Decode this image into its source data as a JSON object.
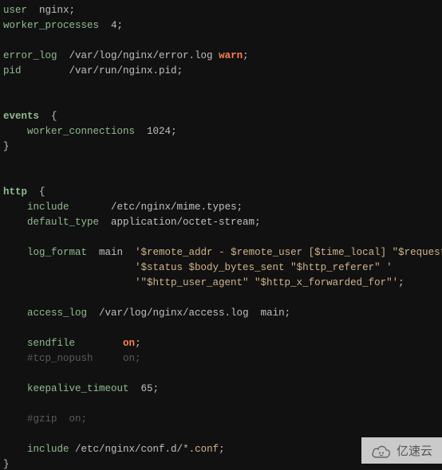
{
  "lines": [
    {
      "indent": 0,
      "segs": [
        {
          "c": "dir",
          "t": "user"
        },
        {
          "c": "val",
          "t": "  nginx"
        },
        {
          "c": "sc",
          "t": ";"
        }
      ]
    },
    {
      "indent": 0,
      "segs": [
        {
          "c": "dir",
          "t": "worker_processes"
        },
        {
          "c": "val",
          "t": "  4"
        },
        {
          "c": "sc",
          "t": ";"
        }
      ]
    },
    {
      "indent": 0,
      "segs": []
    },
    {
      "indent": 0,
      "segs": [
        {
          "c": "dir",
          "t": "error_log"
        },
        {
          "c": "val",
          "t": "  /var/log/nginx/error.log "
        },
        {
          "c": "kw",
          "t": "warn"
        },
        {
          "c": "sc",
          "t": ";"
        }
      ]
    },
    {
      "indent": 0,
      "segs": [
        {
          "c": "dir",
          "t": "pid"
        },
        {
          "c": "val",
          "t": "        /var/run/nginx.pid"
        },
        {
          "c": "sc",
          "t": ";"
        }
      ]
    },
    {
      "indent": 0,
      "segs": []
    },
    {
      "indent": 0,
      "segs": []
    },
    {
      "indent": 0,
      "segs": [
        {
          "c": "dir-b",
          "t": "events"
        },
        {
          "c": "br",
          "t": "  {"
        }
      ]
    },
    {
      "indent": 4,
      "segs": [
        {
          "c": "dir",
          "t": "worker_connections"
        },
        {
          "c": "val",
          "t": "  1024"
        },
        {
          "c": "sc",
          "t": ";"
        }
      ]
    },
    {
      "indent": 0,
      "segs": [
        {
          "c": "br",
          "t": "}"
        }
      ]
    },
    {
      "indent": 0,
      "segs": []
    },
    {
      "indent": 0,
      "segs": []
    },
    {
      "indent": 0,
      "segs": [
        {
          "c": "dir-b",
          "t": "http"
        },
        {
          "c": "br",
          "t": "  {"
        }
      ]
    },
    {
      "indent": 4,
      "segs": [
        {
          "c": "dir",
          "t": "include"
        },
        {
          "c": "val",
          "t": "       /etc/nginx/mime.types"
        },
        {
          "c": "sc",
          "t": ";"
        }
      ]
    },
    {
      "indent": 4,
      "segs": [
        {
          "c": "dir",
          "t": "default_type"
        },
        {
          "c": "val",
          "t": "  application/octet-stream"
        },
        {
          "c": "sc",
          "t": ";"
        }
      ]
    },
    {
      "indent": 0,
      "segs": []
    },
    {
      "indent": 4,
      "segs": [
        {
          "c": "dir",
          "t": "log_format"
        },
        {
          "c": "val",
          "t": "  main  "
        },
        {
          "c": "str",
          "t": "'$remote_addr - $remote_user [$time_local] \"$request\" '"
        }
      ]
    },
    {
      "indent": 22,
      "segs": [
        {
          "c": "str",
          "t": "'$status $body_bytes_sent \"$http_referer\" '"
        }
      ]
    },
    {
      "indent": 22,
      "segs": [
        {
          "c": "str",
          "t": "'\"$http_user_agent\" \"$http_x_forwarded_for\"'"
        },
        {
          "c": "sc",
          "t": ";"
        }
      ]
    },
    {
      "indent": 0,
      "segs": []
    },
    {
      "indent": 4,
      "segs": [
        {
          "c": "dir",
          "t": "access_log"
        },
        {
          "c": "val",
          "t": "  /var/log/nginx/access.log  main"
        },
        {
          "c": "sc",
          "t": ";"
        }
      ]
    },
    {
      "indent": 0,
      "segs": []
    },
    {
      "indent": 4,
      "segs": [
        {
          "c": "dir",
          "t": "sendfile"
        },
        {
          "c": "val",
          "t": "        "
        },
        {
          "c": "kw",
          "t": "on"
        },
        {
          "c": "sc",
          "t": ";"
        }
      ]
    },
    {
      "indent": 4,
      "segs": [
        {
          "c": "cmt",
          "t": "#tcp_nopush     on;"
        }
      ]
    },
    {
      "indent": 0,
      "segs": []
    },
    {
      "indent": 4,
      "segs": [
        {
          "c": "dir",
          "t": "keepalive_timeout"
        },
        {
          "c": "val",
          "t": "  65"
        },
        {
          "c": "sc",
          "t": ";"
        }
      ]
    },
    {
      "indent": 0,
      "segs": []
    },
    {
      "indent": 4,
      "segs": [
        {
          "c": "cmt",
          "t": "#gzip  on;"
        }
      ]
    },
    {
      "indent": 0,
      "segs": []
    },
    {
      "indent": 4,
      "segs": [
        {
          "c": "dir",
          "t": "include"
        },
        {
          "c": "val",
          "t": " /etc/nginx/conf.d/"
        },
        {
          "c": "glob",
          "t": "*.conf"
        },
        {
          "c": "sc",
          "t": ";"
        }
      ]
    },
    {
      "indent": 0,
      "segs": [
        {
          "c": "br",
          "t": "}"
        }
      ]
    }
  ],
  "watermark": {
    "text": "亿速云"
  }
}
